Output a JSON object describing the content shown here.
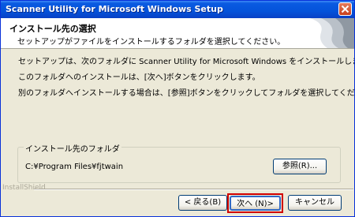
{
  "window": {
    "title": "Scanner Utility for Microsoft Windows Setup"
  },
  "header": {
    "title": "インストール先の選択",
    "subtitle": "セットアップがファイルをインストールするフォルダを選択してください。"
  },
  "body": {
    "line1": "セットアップは、次のフォルダに Scanner Utility for Microsoft Windows をインストールします。",
    "line2": "このフォルダへのインストールは、[次へ]ボタンをクリックします。",
    "line3": "別のフォルダへインストールする場合は、[参照]ボタンをクリックしてフォルダを選択してください。"
  },
  "destination": {
    "group_label": "インストール先のフォルダ",
    "path": "C:¥Program Files¥fjtwain",
    "browse_label": "参照(R)..."
  },
  "footer": {
    "brand": "InstallShield",
    "back_label": "< 戻る(B)",
    "next_label": "次へ (N)>",
    "cancel_label": "キャンセル"
  },
  "colors": {
    "title_bar": "#0453da",
    "highlight_box": "#d00000",
    "dialog_bg": "#ece9d8"
  }
}
